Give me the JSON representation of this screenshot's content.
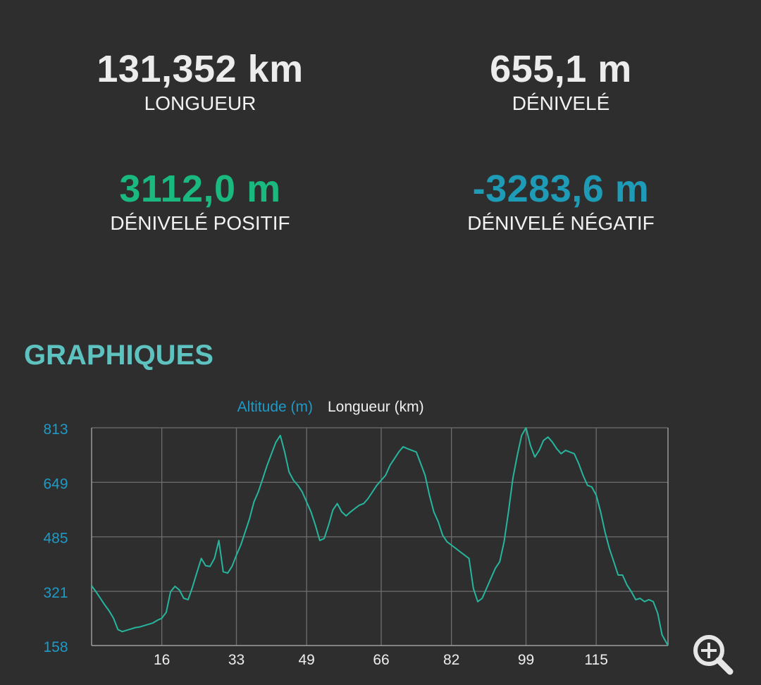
{
  "colors": {
    "background": "#2e2e2e",
    "text": "#ececec",
    "positive": "#19b97f",
    "negative": "#1e9bb6",
    "section_title": "#5ec3c0",
    "altitude_axis": "#1f99c6",
    "line": "#26b59d",
    "grid": "#6e6e6e"
  },
  "stats": {
    "length": {
      "value": "131,352 km",
      "label": "LONGUEUR"
    },
    "elevation": {
      "value": "655,1 m",
      "label": "DÉNIVELÉ"
    },
    "positive": {
      "value": "3112,0 m",
      "label": "DÉNIVELÉ POSITIF"
    },
    "negative": {
      "value": "-3283,6 m",
      "label": "DÉNIVELÉ NÉGATIF"
    }
  },
  "section_title": "GRAPHIQUES",
  "zoom_icon": "zoom-in-icon",
  "chart_data": {
    "type": "line",
    "legend": [
      "Altitude (m)",
      "Longueur (km)"
    ],
    "legend_placement": "top-center",
    "grid": true,
    "xlim": [
      0,
      131.352
    ],
    "ylim": [
      158,
      813
    ],
    "x_ticks": [
      16,
      33,
      49,
      66,
      82,
      99,
      115
    ],
    "y_ticks": [
      158,
      321,
      485,
      649,
      813
    ],
    "series": [
      {
        "name": "Altitude (m)",
        "x": [
          0,
          1,
          2,
          3,
          4,
          5,
          6,
          7,
          8,
          9,
          10,
          11,
          12,
          13,
          14,
          15,
          16,
          17,
          18,
          19,
          20,
          21,
          22,
          23,
          24,
          25,
          26,
          27,
          28,
          29,
          30,
          31,
          32,
          33,
          34,
          35,
          36,
          37,
          38,
          39,
          40,
          41,
          42,
          43,
          44,
          45,
          46,
          47,
          48,
          49,
          50,
          51,
          52,
          53,
          54,
          55,
          56,
          57,
          58,
          59,
          60,
          61,
          62,
          63,
          64,
          65,
          66,
          67,
          68,
          69,
          70,
          71,
          72,
          73,
          74,
          75,
          76,
          77,
          78,
          79,
          80,
          81,
          82,
          83,
          84,
          85,
          86,
          87,
          88,
          89,
          90,
          91,
          92,
          93,
          94,
          95,
          96,
          97,
          98,
          99,
          100,
          101,
          102,
          103,
          104,
          105,
          106,
          107,
          108,
          109,
          110,
          111,
          112,
          113,
          114,
          115,
          116,
          117,
          118,
          119,
          120,
          121,
          122,
          123,
          124,
          125,
          126,
          127,
          128,
          129,
          130,
          131.352
        ],
        "y": [
          338,
          320,
          300,
          280,
          262,
          240,
          206,
          200,
          204,
          208,
          212,
          214,
          218,
          222,
          226,
          234,
          240,
          258,
          320,
          336,
          325,
          300,
          296,
          334,
          378,
          420,
          398,
          396,
          420,
          474,
          380,
          376,
          396,
          430,
          460,
          500,
          540,
          590,
          620,
          660,
          700,
          735,
          770,
          790,
          740,
          680,
          655,
          640,
          620,
          590,
          560,
          520,
          474,
          480,
          520,
          566,
          585,
          560,
          548,
          560,
          570,
          580,
          585,
          600,
          620,
          640,
          655,
          670,
          700,
          720,
          740,
          756,
          750,
          745,
          740,
          705,
          670,
          610,
          560,
          530,
          490,
          470,
          460,
          450,
          440,
          430,
          420,
          330,
          290,
          300,
          330,
          360,
          390,
          410,
          470,
          560,
          660,
          730,
          790,
          813,
          760,
          725,
          745,
          775,
          785,
          770,
          750,
          735,
          745,
          740,
          735,
          705,
          670,
          640,
          635,
          610,
          560,
          500,
          450,
          410,
          370,
          370,
          340,
          320,
          296,
          300,
          290,
          296,
          290,
          255,
          190,
          158
        ]
      }
    ]
  }
}
